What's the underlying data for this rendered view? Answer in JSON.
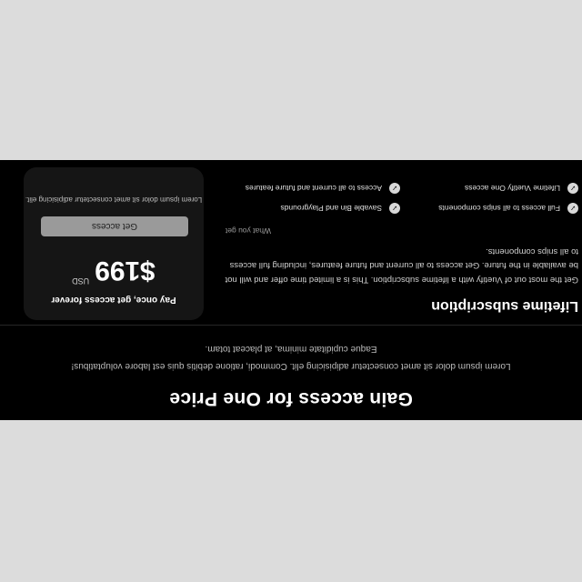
{
  "section": {
    "title": "Gain access for One Price",
    "subtitle": "Lorem ipsum dolor sit amet consectetur adipisicing elit. Commodi, ratione debitis quis est labore voluptatibus! Eaque cupiditate minima, at placeat totam."
  },
  "plan": {
    "title": "Lifetime subscription",
    "description": "Get the most out of Vuetify with a lifetime subscription. This is a limited time offer and will not be available in the future. Get access to all current and future features, including full access to all snips components.",
    "what_you_get": "What you get",
    "features": [
      "Full access to all snips components",
      "Savable Bin and Playgrounds",
      "Lifetime Vuetify One access",
      "Access to all current and future features"
    ]
  },
  "pricing": {
    "pay_once": "Pay once, get access forever",
    "price": "$199",
    "currency": "USD",
    "cta": "Get access",
    "note": "Lorem ipsum dolor sit amet consectetur adipisicing elit."
  },
  "colors": {
    "page_background": "#dcdcdc",
    "band_background": "#000000",
    "card_background": "#151515",
    "button_background": "#9a9a9a"
  },
  "icons": {
    "feature_check": "check-circle-icon"
  }
}
